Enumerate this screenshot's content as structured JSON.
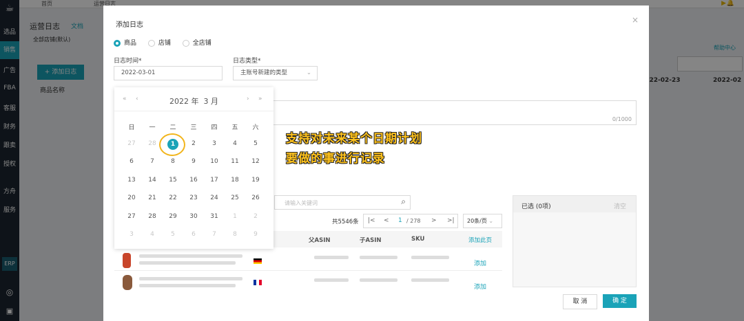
{
  "sidebar": {
    "items": [
      "选品",
      "销售",
      "广告",
      "FBA",
      "客服",
      "财务",
      "跟卖",
      "授权",
      "方舟",
      "服务"
    ],
    "erp": "ERP"
  },
  "topbar": {
    "tabs": [
      "首页",
      "运营日志"
    ]
  },
  "page": {
    "title": "运营日志",
    "doc_link": "文档",
    "shop_select": "全部店铺(默认)",
    "add_log": "+ 添加日志",
    "help": "帮助中心",
    "col_product": "商品名称",
    "date_col1": "2022-02-23",
    "date_col2": "2022-02",
    "per_page_partial": "/页"
  },
  "modal": {
    "title": "添加日志",
    "scope_options": [
      {
        "label": "商品",
        "selected": true
      },
      {
        "label": "店铺",
        "selected": false
      },
      {
        "label": "全店铺",
        "selected": false
      }
    ],
    "date_label": "日志时间*",
    "date_value": "2022-03-01",
    "type_label": "日志类型*",
    "type_value": "主账号新建的类型",
    "char_count": "0/1000",
    "search_placeholder": "请输入关键词",
    "total": "共5546条",
    "page_current": "1",
    "page_total": "/ 278",
    "page_size": "20条/页",
    "columns": [
      "父ASIN",
      "子ASIN",
      "SKU"
    ],
    "add_page": "添加此页",
    "add": "添加",
    "rows": [
      {
        "flag": "de"
      },
      {
        "flag": "fr"
      }
    ],
    "selected_label": "已选 (0项)",
    "clear": "清空",
    "cancel": "取 消",
    "ok": "确 定"
  },
  "calendar": {
    "header": "2022 年  3 月",
    "weekdays": [
      "日",
      "一",
      "二",
      "三",
      "四",
      "五",
      "六"
    ],
    "weeks": [
      [
        "27",
        "28",
        "1",
        "2",
        "3",
        "4",
        "5"
      ],
      [
        "6",
        "7",
        "8",
        "9",
        "10",
        "11",
        "12"
      ],
      [
        "13",
        "14",
        "15",
        "16",
        "17",
        "18",
        "19"
      ],
      [
        "20",
        "21",
        "22",
        "23",
        "24",
        "25",
        "26"
      ],
      [
        "27",
        "28",
        "29",
        "30",
        "31",
        "1",
        "2"
      ],
      [
        "3",
        "4",
        "5",
        "6",
        "7",
        "8",
        "9"
      ]
    ],
    "selected": "1"
  },
  "annotation": {
    "line1": "支持对未来某个日期计划",
    "line2": "要做的事进行记录"
  },
  "colors": {
    "accent": "#1aa3b8",
    "annotation": "#ffc21c"
  }
}
